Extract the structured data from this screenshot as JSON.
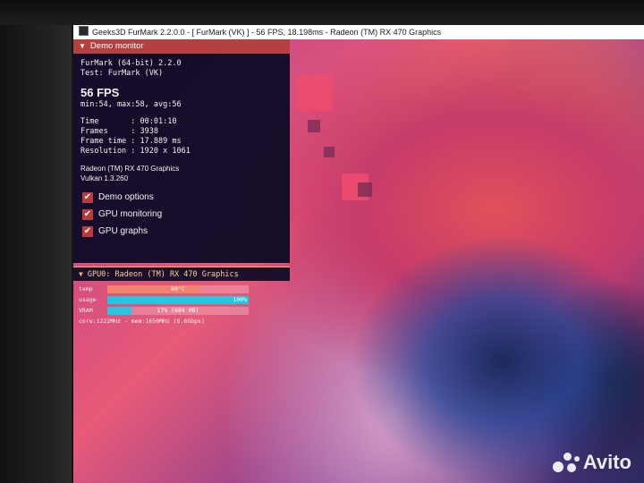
{
  "window": {
    "title": "Geeks3D FurMark 2.2.0.0 - [ FurMark (VK) ] - 56 FPS, 18.198ms - Radeon (TM) RX 470 Graphics"
  },
  "demo_monitor": {
    "header": "Demo monitor",
    "version": "FurMark (64-bit) 2.2.0",
    "test": "Test: FurMark (VK)",
    "fps": "56 FPS",
    "fps_stats": "min:54, max:58, avg:56",
    "time": "Time       : 00:01:10",
    "frames": "Frames     : 3938",
    "frame_time": "Frame time : 17.889 ms",
    "resolution": "Resolution : 1920 x 1061",
    "gpu_name": "Radeon (TM) RX 470 Graphics",
    "vulkan": "Vulkan 1.3.260"
  },
  "options": [
    {
      "label": "Demo options",
      "checked": true
    },
    {
      "label": "GPU monitoring",
      "checked": true
    },
    {
      "label": "GPU graphs",
      "checked": true
    }
  ],
  "gpu_panel": {
    "header": "GPU0: Radeon (TM) RX 470 Graphics",
    "rows": [
      {
        "label": "temp",
        "value": "80°C",
        "fraction": 0.66,
        "color": "#f0826e"
      },
      {
        "label": "usage",
        "value": "100%",
        "fraction": 1.0,
        "color": "#25c7e0"
      },
      {
        "label": "VRAM",
        "value": "17% (684 MB)",
        "fraction": 0.17,
        "color": "#25c7e0"
      }
    ],
    "core_line": "core:1222MHz - mem:1650MHz (6.6Gbps)"
  },
  "watermark": {
    "text": "Avito"
  },
  "icons": {
    "check": "✔",
    "collapse": "▼"
  }
}
